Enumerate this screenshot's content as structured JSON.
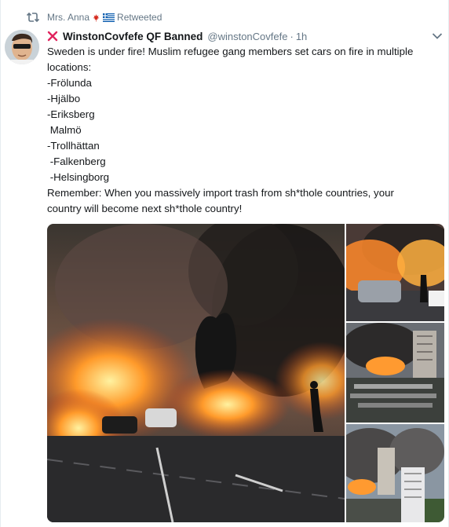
{
  "retweet": {
    "icon": "retweet-icon",
    "user": "Mrs. Anna",
    "flags": [
      "canada-flag",
      "greece-flag"
    ],
    "label": "Retweeted"
  },
  "tweet": {
    "badge_icon": "red-x-icon",
    "display_name": "WinstonCovfefe QF Banned",
    "handle": "@winstonCovfefe",
    "separator": "·",
    "time": "1h",
    "menu_icon": "chevron-down-icon",
    "lines": [
      "Sweden is under fire! Muslim refugee gang members set cars on fire in multiple",
      "locations:",
      "-Frölunda",
      "-Hjälbo",
      "-Eriksberg",
      " Malmö",
      "-Trollhättan",
      " -Falkenberg",
      " -Helsingborg",
      "Remember: When you massively import trash from sh*thole countries, your",
      "country will become next sh*thole country!"
    ]
  },
  "media": {
    "images": [
      "burning-cars-parking-lot-photo",
      "burning-cars-street-photo",
      "burning-cars-apartment-blocks-photo",
      "smoke-over-apartment-buildings-photo"
    ]
  },
  "colors": {
    "text": "#14171a",
    "secondary": "#657786",
    "badge_red": "#e0245e",
    "border": "#e6ecf0"
  }
}
